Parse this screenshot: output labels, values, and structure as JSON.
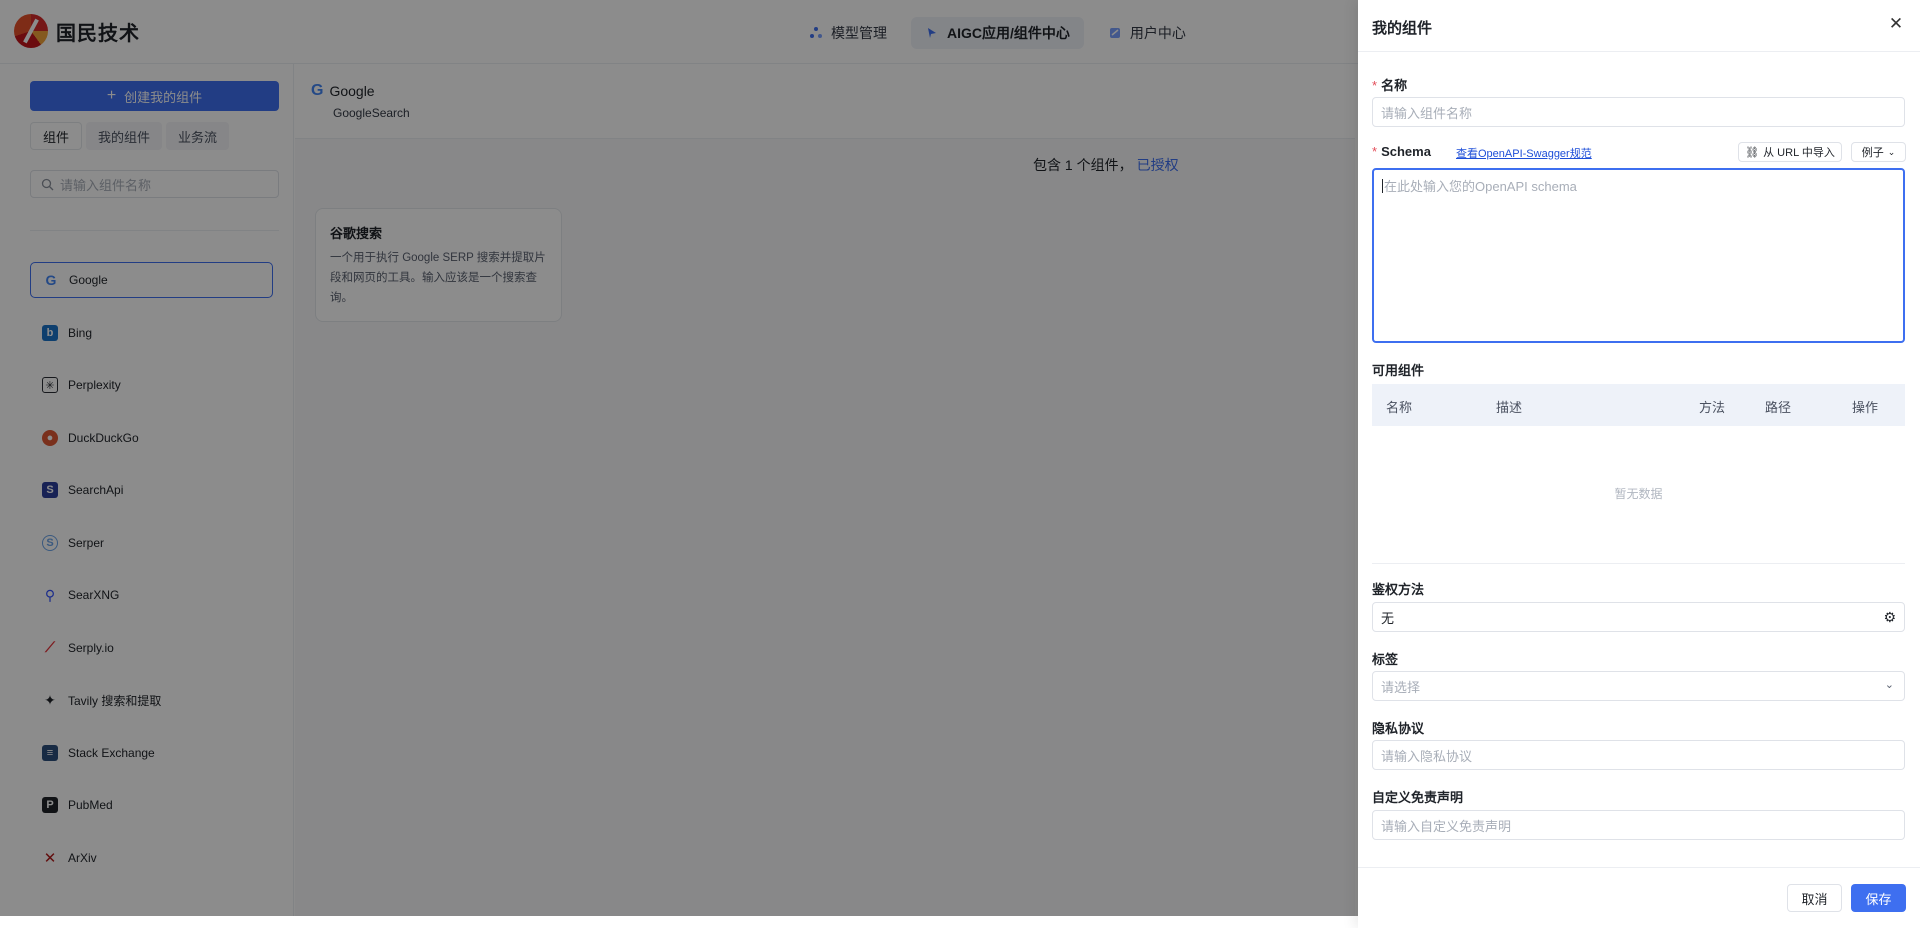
{
  "app": {
    "logo_text": "国民技术"
  },
  "nav": [
    {
      "label": "模型管理",
      "icon": "model-icon"
    },
    {
      "label": "AIGC应用/组件中心",
      "icon": "app-icon"
    },
    {
      "label": "用户中心",
      "icon": "user-icon"
    }
  ],
  "sidebar": {
    "create_button": "创建我的组件",
    "tabs": [
      "组件",
      "我的组件",
      "业务流"
    ],
    "search_placeholder": "请输入组件名称",
    "providers": [
      {
        "label": "Google",
        "icon": "google-icon",
        "color": "#4285f4"
      },
      {
        "label": "Bing",
        "icon": "bing-icon",
        "color": "#1a73c8"
      },
      {
        "label": "Perplexity",
        "icon": "perplexity-icon",
        "color": "#2b2f36"
      },
      {
        "label": "DuckDuckGo",
        "icon": "duckduckgo-icon",
        "color": "#de5833"
      },
      {
        "label": "SearchApi",
        "icon": "searchapi-icon",
        "color": "#2d3f9b"
      },
      {
        "label": "Serper",
        "icon": "serper-icon",
        "color": "#6aa3e8"
      },
      {
        "label": "SearXNG",
        "icon": "searxng-icon",
        "color": "#3050ff"
      },
      {
        "label": "Serply.io",
        "icon": "serply-icon",
        "color": "#e5343b"
      },
      {
        "label": "Tavily 搜索和提取",
        "icon": "tavily-icon",
        "color": "#1f2329"
      },
      {
        "label": "Stack Exchange",
        "icon": "stackexchange-icon",
        "color": "#2d4f7c"
      },
      {
        "label": "PubMed",
        "icon": "pubmed-icon",
        "color": "#1f2329"
      },
      {
        "label": "ArXiv",
        "icon": "arxiv-icon",
        "color": "#b31b1b"
      }
    ]
  },
  "main": {
    "title": "Google",
    "subtitle": "GoogleSearch",
    "summary": "包含 1 个组件，",
    "summary_link": "已授权",
    "card": {
      "title": "谷歌搜索",
      "description": "一个用于执行 Google SERP 搜索并提取片段和网页的工具。输入应该是一个搜索查询。"
    }
  },
  "drawer": {
    "title": "我的组件",
    "name_label": "名称",
    "name_placeholder": "请输入组件名称",
    "schema_label": "Schema",
    "schema_link": "查看OpenAPI-Swagger规范",
    "import_button": "从 URL 中导入",
    "example_button": "例子",
    "schema_placeholder": "在此处输入您的OpenAPI schema",
    "available_label": "可用组件",
    "table_columns": [
      "名称",
      "描述",
      "方法",
      "路径",
      "操作"
    ],
    "empty_text": "暂无数据",
    "auth_label": "鉴权方法",
    "auth_value": "无",
    "tags_label": "标签",
    "tags_placeholder": "请选择",
    "privacy_label": "隐私协议",
    "privacy_placeholder": "请输入隐私协议",
    "disclaimer_label": "自定义免责声明",
    "disclaimer_placeholder": "请输入自定义免责声明",
    "cancel_button": "取消",
    "save_button": "保存"
  }
}
